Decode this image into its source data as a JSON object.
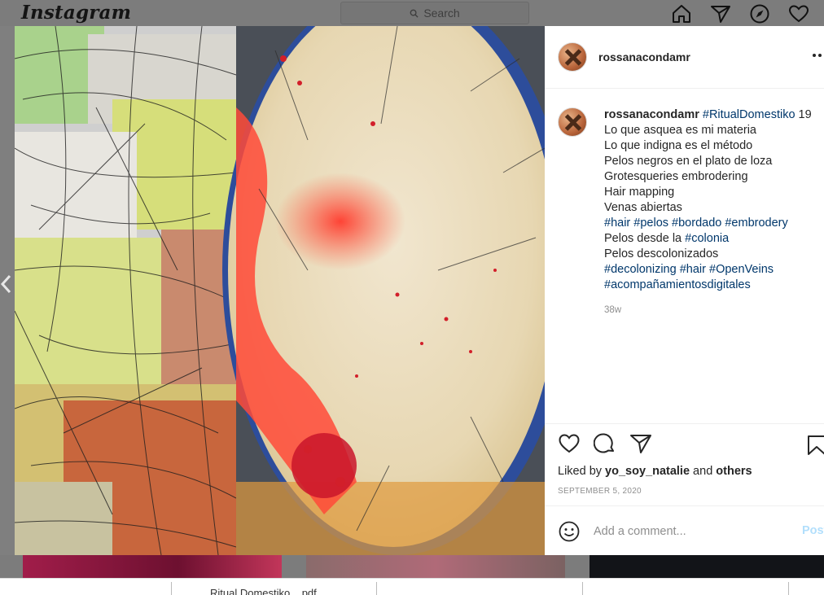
{
  "header": {
    "logo": "Instagram",
    "search_placeholder": "Search"
  },
  "post": {
    "username": "rossanacondamr",
    "caption": {
      "username": "rossanacondamr",
      "first_line_tag": "#RitualDomestiko",
      "first_line_suffix": " 19",
      "line2": "Lo que asquea es mi materia",
      "line3": "Lo que indigna es el método",
      "line4": "Pelos negros en el plato de loza",
      "line5": "Grotesqueries embrodering",
      "line6": "Hair mapping",
      "line7": "Venas abiertas",
      "line8_tags": [
        "#hair",
        "#pelos",
        "#bordado",
        "#embrodery"
      ],
      "line9_prefix": "Pelos desde la ",
      "line9_tag": "#colonia",
      "line10": "Pelos descolonizados",
      "line11_tags": [
        "#decolonizing",
        "#hair",
        "#OpenVeins"
      ],
      "line12_tag": "#acompañamientosdigitales"
    },
    "time_ago": "38w",
    "liked_by_prefix": "Liked by ",
    "liked_by_user": "yo_soy_natalie",
    "liked_by_and": " and ",
    "liked_by_others": "others",
    "date": "SEPTEMBER 5, 2020",
    "comment_placeholder": "Add a comment...",
    "post_button": "Post"
  },
  "taskbar": {
    "file_name": "Ritual Domestiko....pdf"
  },
  "colors": {
    "hashtag": "#00376b",
    "post_button_disabled": "#b2dffc",
    "overlay": "#7f7f7f"
  }
}
